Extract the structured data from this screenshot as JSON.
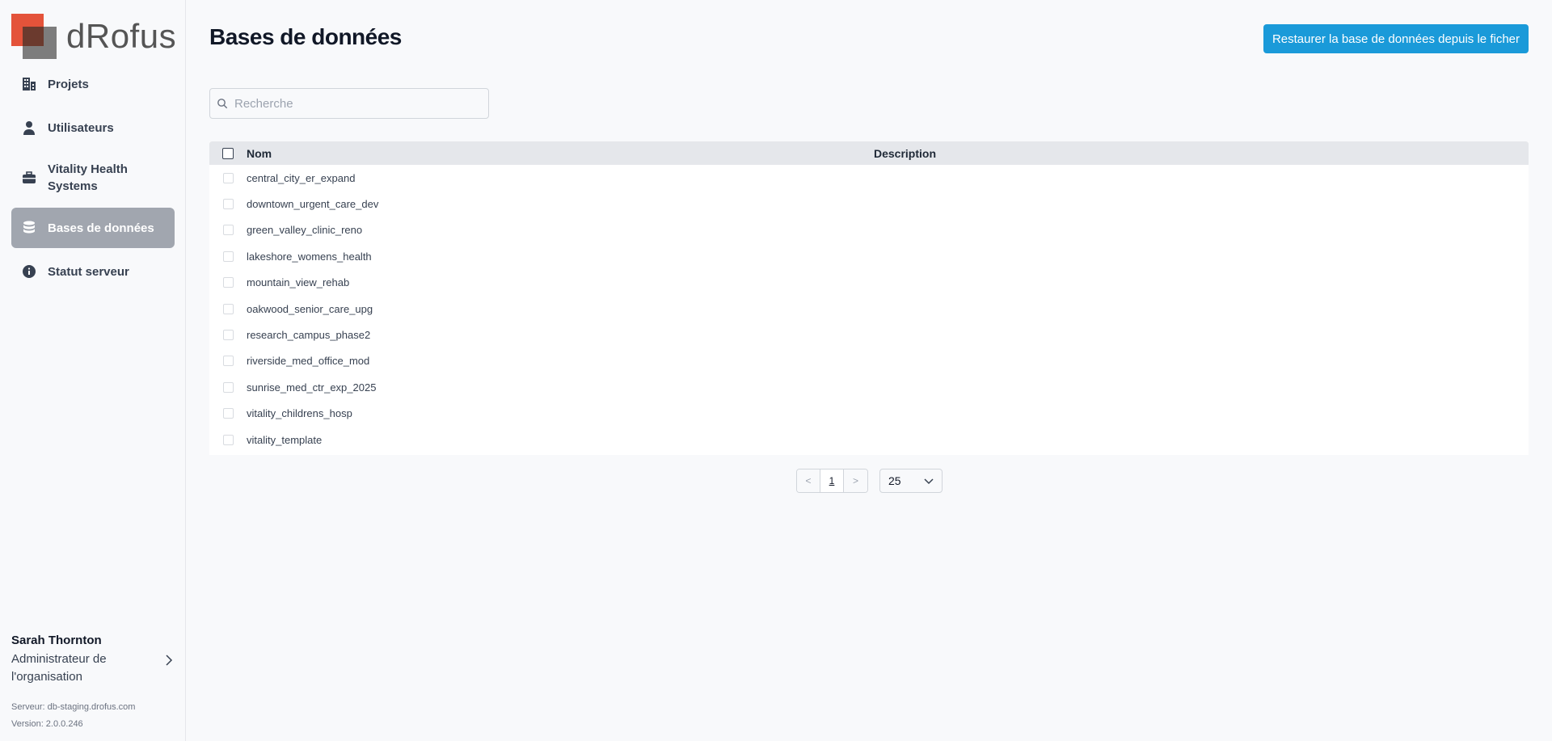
{
  "app": {
    "logo_text": "dRofus"
  },
  "sidebar": {
    "items": [
      {
        "label": "Projets",
        "icon": "building-icon"
      },
      {
        "label": "Utilisateurs",
        "icon": "user-icon"
      },
      {
        "label": "Vitality Health Systems",
        "icon": "briefcase-icon"
      },
      {
        "label": "Bases de données",
        "icon": "database-icon",
        "active": true
      },
      {
        "label": "Statut serveur",
        "icon": "info-icon"
      }
    ]
  },
  "user": {
    "name": "Sarah Thornton",
    "role": "Administrateur de l'organisation",
    "server": "Serveur: db-staging.drofus.com",
    "version": "Version: 2.0.0.246"
  },
  "header": {
    "title": "Bases de données",
    "restore_button": "Restaurer la base de données depuis le ficher"
  },
  "search": {
    "placeholder": "Recherche",
    "value": ""
  },
  "table": {
    "columns": [
      "Nom",
      "Description"
    ],
    "rows": [
      {
        "name": "central_city_er_expand",
        "description": ""
      },
      {
        "name": "downtown_urgent_care_dev",
        "description": ""
      },
      {
        "name": "green_valley_clinic_reno",
        "description": ""
      },
      {
        "name": "lakeshore_womens_health",
        "description": ""
      },
      {
        "name": "mountain_view_rehab",
        "description": ""
      },
      {
        "name": "oakwood_senior_care_upg",
        "description": ""
      },
      {
        "name": "research_campus_phase2",
        "description": ""
      },
      {
        "name": "riverside_med_office_mod",
        "description": ""
      },
      {
        "name": "sunrise_med_ctr_exp_2025",
        "description": ""
      },
      {
        "name": "vitality_childrens_hosp",
        "description": ""
      },
      {
        "name": "vitality_template",
        "description": ""
      }
    ]
  },
  "pagination": {
    "prev": "<",
    "current_page": "1",
    "next": ">",
    "page_size": "25"
  },
  "colors": {
    "accent": "#1a9ad9",
    "active_nav": "#a1a6af",
    "logo_red": "#e4533a",
    "logo_gray": "#7d7d7d"
  }
}
